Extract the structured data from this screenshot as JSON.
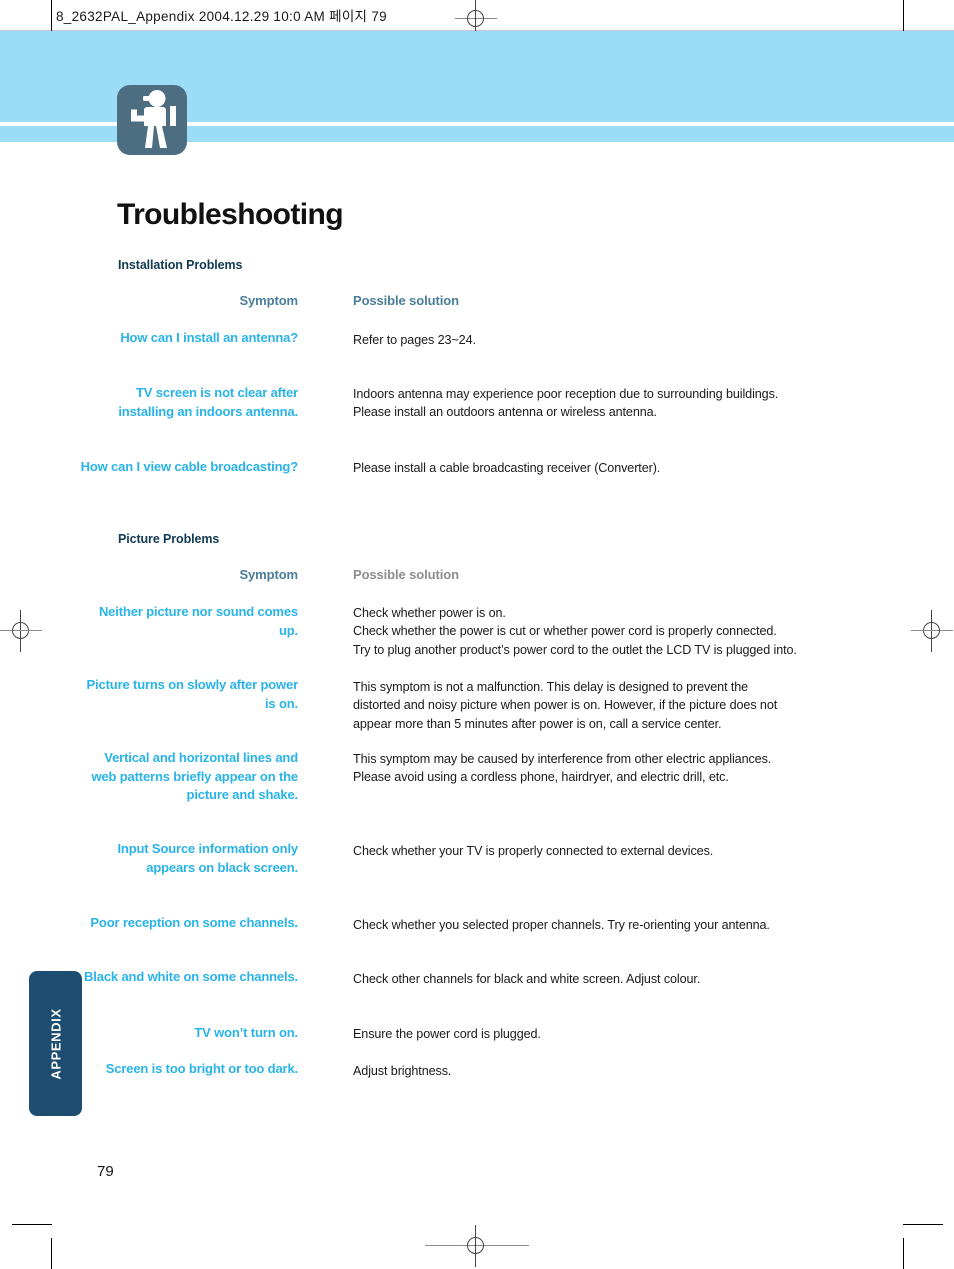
{
  "print_header": {
    "text": "8_2632PAL_Appendix  2004.12.29 10:0 AM 페이지 79"
  },
  "icon": {
    "name": "hiker-icon"
  },
  "page_title": "Troubleshooting",
  "colors": {
    "banner": "#9bdcf7",
    "icon_tile": "#4d6e80",
    "symptom_text": "#29b3e8",
    "section_heading": "#123a52",
    "column_head_slate": "#4a7d99",
    "column_head_gray": "#8d8d8d",
    "side_tab": "#1d4e72"
  },
  "sections": [
    {
      "heading": "Installation Problems",
      "columns": {
        "symptom": "Symptom",
        "solution": "Possible solution",
        "solution_tone": "tone-slate"
      },
      "rows": [
        {
          "symptom": "How can I install an antenna?",
          "solution": [
            "Refer to pages 23~24."
          ]
        },
        {
          "symptom": "TV screen is not clear after installing an indoors antenna.",
          "solution": [
            "Indoors antenna may experience poor reception due to surrounding buildings.",
            "Please install an outdoors antenna or wireless antenna."
          ]
        },
        {
          "symptom": "How can I view cable broadcasting?",
          "solution": [
            "Please install a cable broadcasting receiver (Converter)."
          ]
        }
      ]
    },
    {
      "heading": "Picture Problems",
      "columns": {
        "symptom": "Symptom",
        "solution": "Possible solution",
        "solution_tone": "tone-gray"
      },
      "rows": [
        {
          "symptom": "Neither picture nor sound comes up.",
          "solution": [
            "Check whether power is on.",
            "Check whether the power is cut or whether power cord is properly connected.",
            "Try to plug another product’s power cord to the outlet the LCD TV is plugged into."
          ]
        },
        {
          "symptom": "Picture turns on slowly after power is on.",
          "solution": [
            "This symptom is not a malfunction. This delay is designed to prevent the",
            "distorted and noisy picture when power is on. However, if the picture does not",
            "appear more than 5 minutes after power is on, call a service center."
          ]
        },
        {
          "symptom": "Vertical and horizontal lines and web patterns briefly appear on the picture and shake.",
          "solution": [
            "This symptom may be caused by interference from other electric appliances.",
            "Please avoid using a cordless phone, hairdryer, and electric drill, etc."
          ]
        },
        {
          "symptom": "Input Source information only appears on black screen.",
          "solution": [
            "Check whether your TV is properly connected to external devices."
          ]
        },
        {
          "symptom": "Poor reception on some channels.",
          "solution": [
            "Check whether you selected proper channels. Try re-orienting your antenna."
          ]
        },
        {
          "symptom": "Black and white on some channels.",
          "solution": [
            "Check other channels for black and white screen. Adjust colour."
          ]
        },
        {
          "symptom": "TV won’t turn on.",
          "solution": [
            "Ensure the power cord is plugged."
          ]
        },
        {
          "symptom": "Screen is too bright or too dark.",
          "solution": [
            "Adjust brightness."
          ]
        }
      ]
    }
  ],
  "side_tab": {
    "label": "APPENDIX"
  },
  "page_number": "79",
  "layout": {
    "section_tops": [
      258,
      532
    ],
    "colhead_tops": [
      293,
      567
    ],
    "row_tops": [
      [
        330,
        384,
        459
      ],
      [
        604,
        677,
        750,
        841,
        915,
        969,
        1024,
        1061
      ]
    ],
    "row_solution_tops": [
      [
        331,
        385,
        459
      ],
      [
        604,
        678,
        750,
        842,
        916,
        970,
        1025,
        1062
      ]
    ]
  }
}
